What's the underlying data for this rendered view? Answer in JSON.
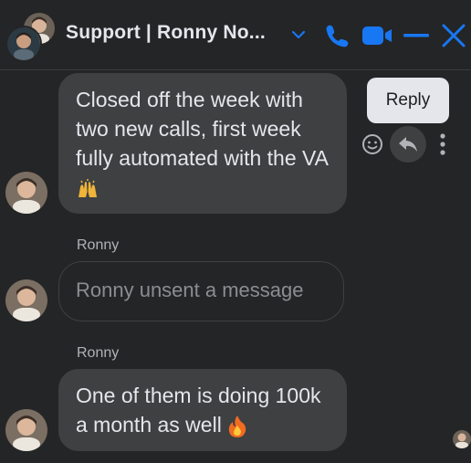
{
  "header": {
    "title": "Support | Ronny No...",
    "accent_color": "#1877f2",
    "icons": [
      "chevron-down-icon",
      "phone-icon",
      "video-icon",
      "minimize-icon",
      "close-icon"
    ]
  },
  "messages": [
    {
      "sender": "",
      "text": "Closed off the week with two new calls, first week fully automated with the VA",
      "emoji": "raised-hands-emoji"
    },
    {
      "sender": "Ronny",
      "text": "Ronny unsent a message",
      "unsent": true
    },
    {
      "sender": "Ronny",
      "text": "One of them is doing 100k a month as well",
      "emoji": "fire-emoji"
    }
  ],
  "hover_actions": {
    "tooltip": "Reply",
    "icons": [
      "emoji-reaction-icon",
      "reply-icon",
      "more-options-icon"
    ]
  }
}
